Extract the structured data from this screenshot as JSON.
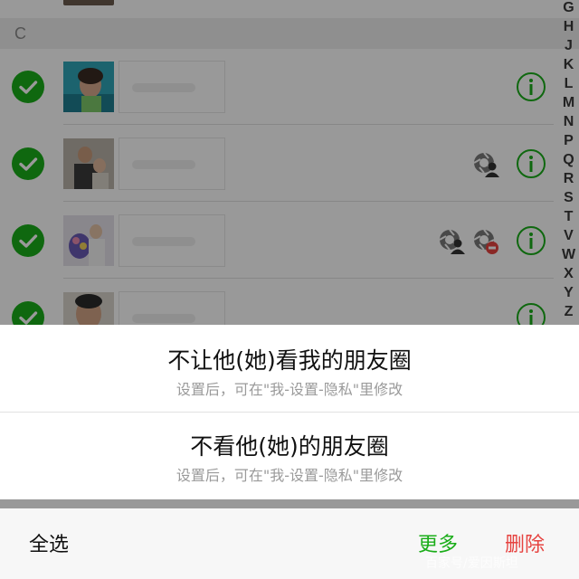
{
  "list": {
    "section_letter": "C",
    "rows": [
      {
        "selected": true,
        "permission_icons": []
      },
      {
        "selected": true,
        "permission_icons": [
          "hide-moments-icon"
        ]
      },
      {
        "selected": true,
        "permission_icons": [
          "hide-moments-icon",
          "blocked-moments-icon"
        ]
      },
      {
        "selected": true,
        "permission_icons": []
      }
    ]
  },
  "alphabet_index": [
    "G",
    "H",
    "J",
    "K",
    "L",
    "M",
    "N",
    "P",
    "Q",
    "R",
    "S",
    "T",
    "V",
    "W",
    "X",
    "Y",
    "Z"
  ],
  "action_sheet": {
    "options": [
      {
        "title": "不让他(她)看我的朋友圈",
        "subtitle": "设置后，可在\"我-设置-隐私\"里修改"
      },
      {
        "title": "不看他(她)的朋友圈",
        "subtitle": "设置后，可在\"我-设置-隐私\"里修改"
      }
    ]
  },
  "bottom_bar": {
    "select_all": "全选",
    "more": "更多",
    "delete": "删除"
  },
  "watermark": "百家号/爱因斯坦",
  "colors": {
    "accent_green": "#1aad19",
    "delete_red": "#e64340",
    "section_bg": "#efefef"
  }
}
